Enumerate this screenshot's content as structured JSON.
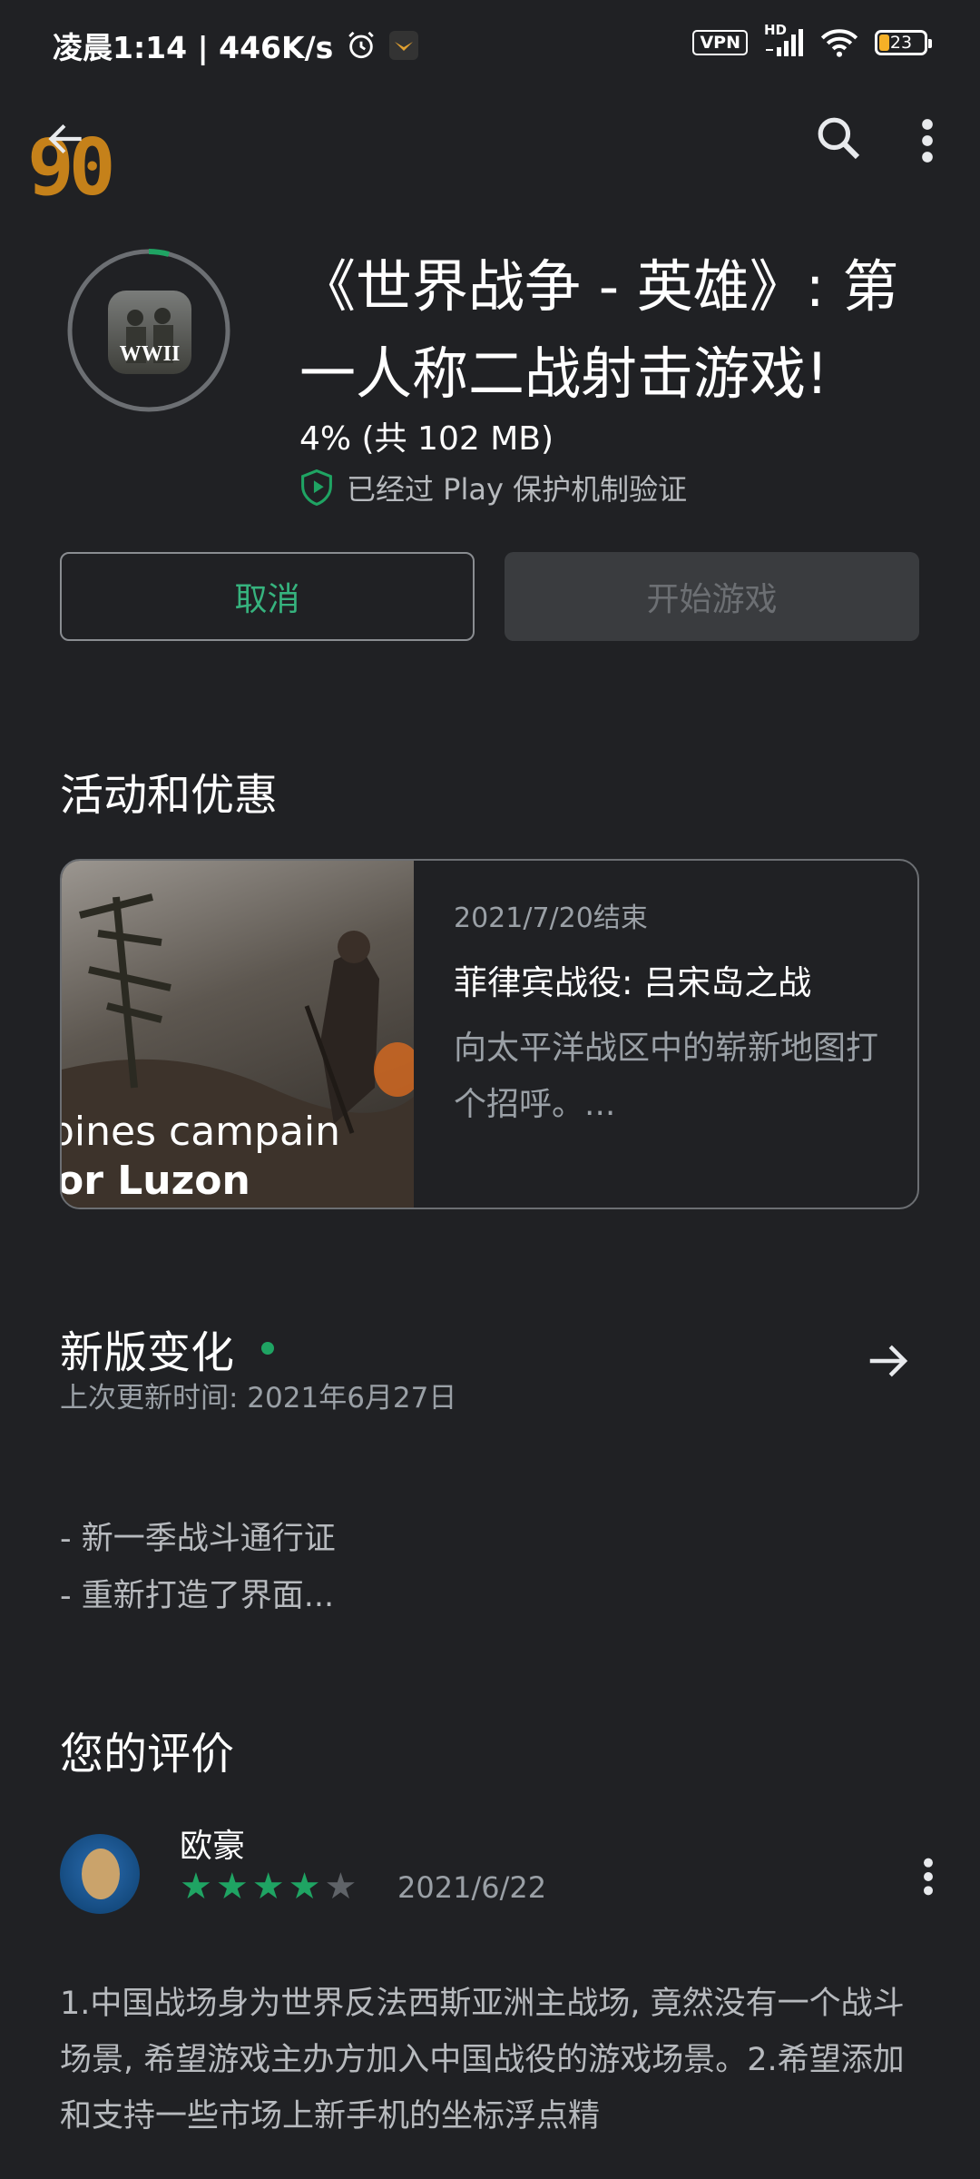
{
  "status_bar": {
    "time_speed": "凌晨1:14 | 446K/s",
    "vpn": "VPN",
    "hd": "HD",
    "battery": "23"
  },
  "app": {
    "title": "《世界战争 - 英雄》: 第一人称二战射击游戏!",
    "icon_text": "WWII",
    "progress": "4% (共 102 MB)",
    "verified": "已经过 Play 保护机制验证"
  },
  "buttons": {
    "cancel": "取消",
    "play": "开始游戏"
  },
  "watermark": "90",
  "promo": {
    "section_title": "活动和优惠",
    "image_text_1": "pines campain",
    "image_text_2": "or Luzon",
    "date": "2021/7/20结束",
    "title": "菲律宾战役: 吕宋岛之战",
    "desc": "向太平洋战区中的崭新地图打个招呼。..."
  },
  "whats_new": {
    "title": "新版变化",
    "subtitle": "上次更新时间: 2021年6月27日",
    "items": [
      "- 新一季战斗通行证",
      "- 重新打造了界面..."
    ]
  },
  "review": {
    "section_title": "您的评价",
    "reviewer": "欧豪",
    "rating": 4,
    "max_rating": 5,
    "date": "2021/6/22",
    "text": "1.中国战场身为世界反法西斯亚洲主战场, 竟然没有一个战斗场景, 希望游戏主办方加入中国战役的游戏场景。2.希望添加和支持一些市场上新手机的坐标浮点精"
  },
  "colors": {
    "background": "#202124",
    "accent": "#36b37e",
    "star_filled": "#1fa463",
    "star_empty": "#5f6368"
  },
  "icons": [
    "back-arrow-icon",
    "search-icon",
    "more-vert-icon",
    "alarm-icon",
    "wifi-icon",
    "signal-icon",
    "battery-icon",
    "shield-play-icon",
    "arrow-right-icon",
    "star-icon"
  ]
}
